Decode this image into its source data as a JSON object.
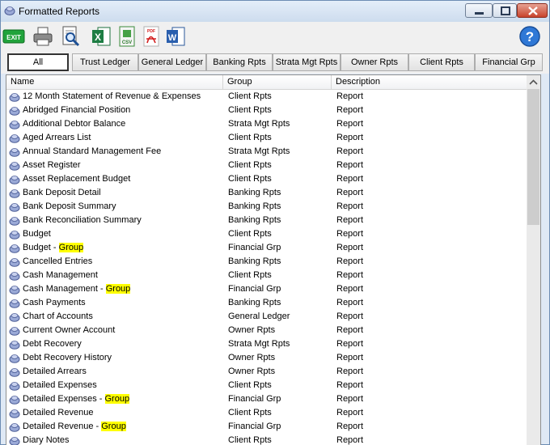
{
  "window": {
    "title": "Formatted Reports"
  },
  "toolbar": {
    "exit_label": "EXIT",
    "csv_label": "CSV",
    "pdf_label": "PDF",
    "help_label": "?"
  },
  "filters": [
    "All",
    "Trust Ledger",
    "General Ledger",
    "Banking Rpts",
    "Strata Mgt Rpts",
    "Owner Rpts",
    "Client Rpts",
    "Financial Grp"
  ],
  "columns": {
    "name": "Name",
    "group": "Group",
    "description": "Description"
  },
  "highlight_term": "Group",
  "rows": [
    {
      "name": "12 Month Statement of Revenue & Expenses",
      "group": "Client Rpts",
      "desc": "Report"
    },
    {
      "name": "Abridged Financial Position",
      "group": "Client Rpts",
      "desc": "Report"
    },
    {
      "name": "Additional Debtor Balance",
      "group": "Strata Mgt Rpts",
      "desc": "Report"
    },
    {
      "name": "Aged Arrears List",
      "group": "Client Rpts",
      "desc": "Report"
    },
    {
      "name": "Annual Standard Management Fee",
      "group": "Strata Mgt Rpts",
      "desc": "Report"
    },
    {
      "name": "Asset Register",
      "group": "Client Rpts",
      "desc": "Report"
    },
    {
      "name": "Asset Replacement Budget",
      "group": "Client Rpts",
      "desc": "Report"
    },
    {
      "name": "Bank Deposit Detail",
      "group": "Banking Rpts",
      "desc": "Report"
    },
    {
      "name": "Bank Deposit Summary",
      "group": "Banking Rpts",
      "desc": "Report"
    },
    {
      "name": "Bank Reconciliation Summary",
      "group": "Banking Rpts",
      "desc": "Report"
    },
    {
      "name": "Budget",
      "group": "Client Rpts",
      "desc": "Report"
    },
    {
      "name": "Budget - Group",
      "group": "Financial Grp",
      "desc": "Report"
    },
    {
      "name": "Cancelled Entries",
      "group": "Banking Rpts",
      "desc": "Report"
    },
    {
      "name": "Cash Management",
      "group": "Client Rpts",
      "desc": "Report"
    },
    {
      "name": "Cash Management - Group",
      "group": "Financial Grp",
      "desc": "Report"
    },
    {
      "name": "Cash Payments",
      "group": "Banking Rpts",
      "desc": "Report"
    },
    {
      "name": "Chart of Accounts",
      "group": "General Ledger",
      "desc": "Report"
    },
    {
      "name": "Current Owner Account",
      "group": "Owner Rpts",
      "desc": "Report"
    },
    {
      "name": "Debt Recovery",
      "group": "Strata Mgt Rpts",
      "desc": "Report"
    },
    {
      "name": "Debt Recovery History",
      "group": "Owner Rpts",
      "desc": "Report"
    },
    {
      "name": "Detailed Arrears",
      "group": "Owner Rpts",
      "desc": "Report"
    },
    {
      "name": "Detailed Expenses",
      "group": "Client Rpts",
      "desc": "Report"
    },
    {
      "name": "Detailed Expenses - Group",
      "group": "Financial Grp",
      "desc": "Report"
    },
    {
      "name": "Detailed Revenue",
      "group": "Client Rpts",
      "desc": "Report"
    },
    {
      "name": "Detailed Revenue - Group",
      "group": "Financial Grp",
      "desc": "Report"
    },
    {
      "name": "Diary Notes",
      "group": "Client Rpts",
      "desc": "Report"
    }
  ],
  "colors": {
    "highlight": "#ffff00",
    "close_button": "#c8432c",
    "title_bar": "#dfe9f5"
  }
}
